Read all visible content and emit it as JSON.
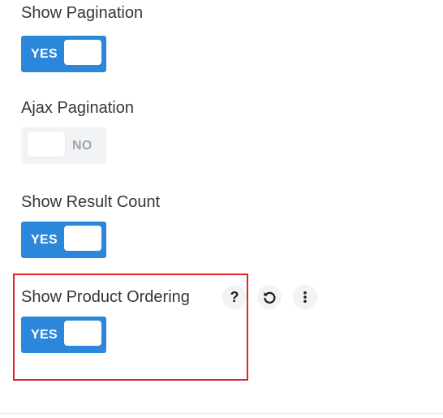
{
  "settings": [
    {
      "label": "Show Pagination",
      "state": "YES"
    },
    {
      "label": "Ajax Pagination",
      "state": "NO"
    },
    {
      "label": "Show Result Count",
      "state": "YES"
    },
    {
      "label": "Show Product Ordering",
      "state": "YES"
    }
  ],
  "actions": {
    "help": "?",
    "reset_icon": "reset-icon",
    "more_icon": "more-vertical-icon"
  },
  "colors": {
    "toggle_on": "#2b87da",
    "toggle_off": "#f1f3f5",
    "highlight": "#e0242a",
    "text": "#32373c"
  }
}
